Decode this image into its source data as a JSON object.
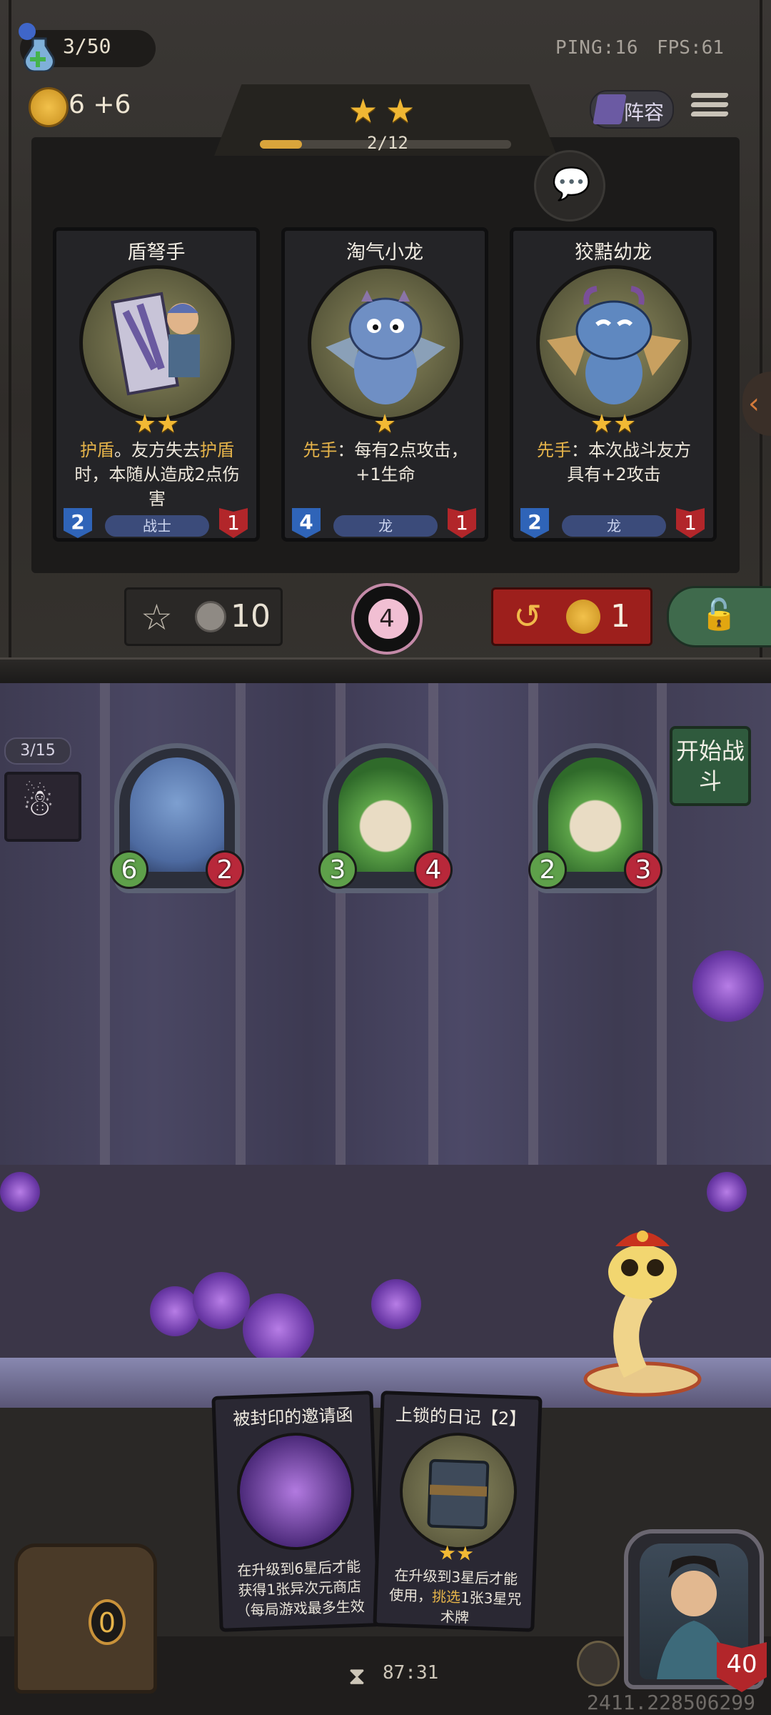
{
  "hud": {
    "xp_text": "3/50",
    "gold_text": "6 +6",
    "ping": "PING:16",
    "fps": "FPS:61",
    "lineup_label": "阵容"
  },
  "tier": {
    "stars": "★",
    "progress_text": "2/12",
    "progress_fraction": 0.167
  },
  "shop": {
    "cards": [
      {
        "name": "盾弩手",
        "stars": "★★",
        "desc_kw1": "护盾",
        "desc_mid1": "。友方失去",
        "desc_kw2": "护盾",
        "desc_rest": "时，本随从造成2点伤害",
        "attack": "2",
        "health": "1",
        "tribe": "战士"
      },
      {
        "name": "淘气小龙",
        "stars": "★",
        "desc_kw1": "先手",
        "desc_mid1": "：每有2点攻击，+1生命",
        "desc_kw2": "",
        "desc_rest": "",
        "attack": "4",
        "health": "1",
        "tribe": "龙"
      },
      {
        "name": "狡黠幼龙",
        "stars": "★★",
        "desc_kw1": "先手",
        "desc_mid1": "：本次战斗友方具有+2攻击",
        "desc_kw2": "",
        "desc_rest": "",
        "attack": "2",
        "health": "1",
        "tribe": "龙"
      }
    ],
    "upgrade_cost": "10",
    "reroll_count": "4",
    "refresh_cost": "1"
  },
  "board": {
    "round_label": "3/15",
    "start_battle_label": "开始战斗",
    "minions": [
      {
        "attack": "6",
        "health": "2"
      },
      {
        "attack": "3",
        "health": "4"
      },
      {
        "attack": "2",
        "health": "3"
      }
    ]
  },
  "hand": {
    "cards": [
      {
        "name": "被封印的邀请函",
        "stars": "",
        "desc": "在升级到6星后才能获得1张异次元商店（每局游戏最多生效"
      },
      {
        "name": "上锁的日记【2】",
        "stars": "★★",
        "desc_pre": "在升级到3星后才能使用，",
        "desc_kw": "挑选",
        "desc_post": "1张3星咒术牌"
      }
    ]
  },
  "footer": {
    "chest_count": "0",
    "timer": "87:31",
    "hero_health": "40",
    "build_id": "2411.228506299"
  },
  "colors": {
    "gold_accent": "#f0b733",
    "keyword": "#e6b44a",
    "refresh_red": "#9d1f1c",
    "lock_green": "#3f6a4c"
  }
}
